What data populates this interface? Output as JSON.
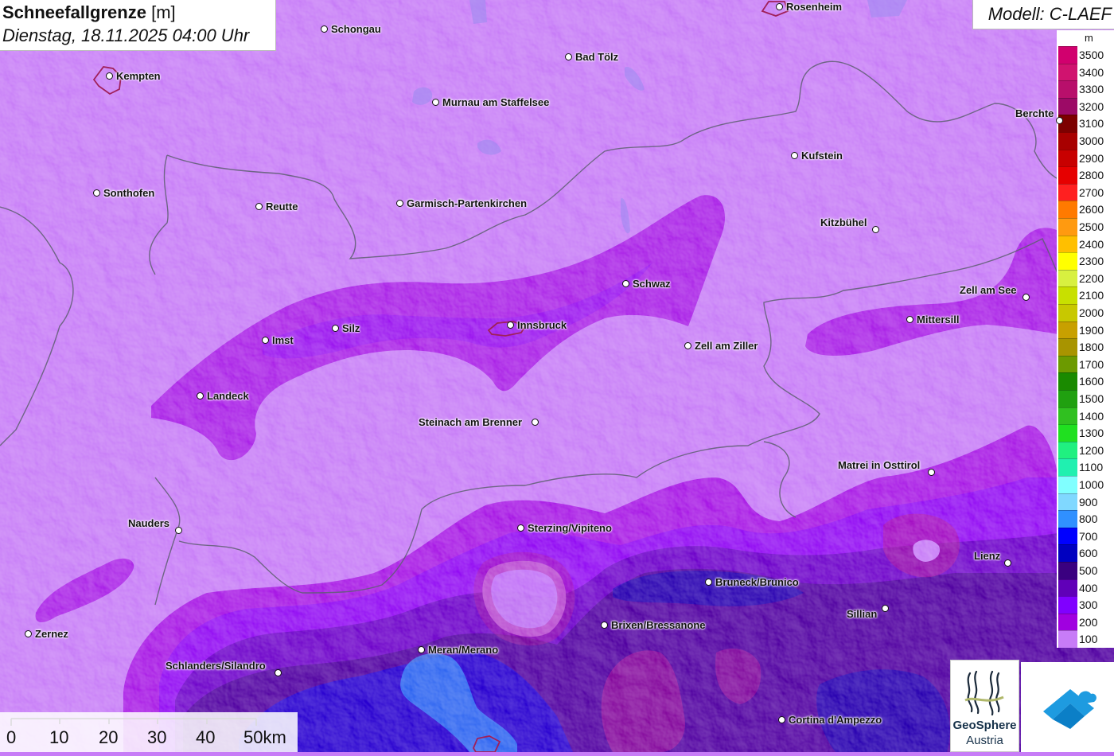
{
  "title": {
    "variable": "Schneefallgrenze",
    "unit": "[m]",
    "datetime": "Dienstag, 18.11.2025 04:00 Uhr"
  },
  "model_label": "Modell: C-LAEF",
  "legend": {
    "unit": "m",
    "entries": [
      {
        "label": "3500",
        "color": "#d1006e"
      },
      {
        "label": "3400",
        "color": "#d0136f"
      },
      {
        "label": "3300",
        "color": "#b80f6b"
      },
      {
        "label": "3200",
        "color": "#9c0a66"
      },
      {
        "label": "3100",
        "color": "#7d0000"
      },
      {
        "label": "3000",
        "color": "#a80000"
      },
      {
        "label": "2900",
        "color": "#c80000"
      },
      {
        "label": "2800",
        "color": "#e60000"
      },
      {
        "label": "2700",
        "color": "#ff2020"
      },
      {
        "label": "2600",
        "color": "#ff7a00"
      },
      {
        "label": "2500",
        "color": "#ff9a10"
      },
      {
        "label": "2400",
        "color": "#ffbf00"
      },
      {
        "label": "2300",
        "color": "#ffff00"
      },
      {
        "label": "2200",
        "color": "#d8f040"
      },
      {
        "label": "2100",
        "color": "#c8e000"
      },
      {
        "label": "2000",
        "color": "#c8c800"
      },
      {
        "label": "1900",
        "color": "#c8a000"
      },
      {
        "label": "1800",
        "color": "#a89400"
      },
      {
        "label": "1700",
        "color": "#6c9a00"
      },
      {
        "label": "1600",
        "color": "#1a8a00"
      },
      {
        "label": "1500",
        "color": "#20a010"
      },
      {
        "label": "1400",
        "color": "#30c020"
      },
      {
        "label": "1300",
        "color": "#20e020"
      },
      {
        "label": "1200",
        "color": "#20f080"
      },
      {
        "label": "1100",
        "color": "#20f0b0"
      },
      {
        "label": "1000",
        "color": "#80ffff"
      },
      {
        "label": "900",
        "color": "#80d8ff"
      },
      {
        "label": "800",
        "color": "#3090ff"
      },
      {
        "label": "700",
        "color": "#0000ff"
      },
      {
        "label": "600",
        "color": "#0000c0"
      },
      {
        "label": "500",
        "color": "#3a0080"
      },
      {
        "label": "400",
        "color": "#6000b8"
      },
      {
        "label": "300",
        "color": "#8000ff"
      },
      {
        "label": "200",
        "color": "#a000e0"
      },
      {
        "label": "100",
        "color": "#c77cf7"
      }
    ]
  },
  "cities": [
    {
      "name": "Rosenheim",
      "label_side": "right"
    },
    {
      "name": "Schongau",
      "label_side": "right"
    },
    {
      "name": "Kempten",
      "label_side": "right"
    },
    {
      "name": "Bad Tölz",
      "label_side": "right"
    },
    {
      "name": "Murnau am Staffelsee",
      "label_side": "right"
    },
    {
      "name": "Berchte",
      "label_side": "left"
    },
    {
      "name": "Kufstein",
      "label_side": "right"
    },
    {
      "name": "Sonthofen",
      "label_side": "right"
    },
    {
      "name": "Reutte",
      "label_side": "right"
    },
    {
      "name": "Garmisch-Partenkirchen",
      "label_side": "right"
    },
    {
      "name": "Kitzbühel",
      "label_side": "left"
    },
    {
      "name": "Schwaz",
      "label_side": "right"
    },
    {
      "name": "Zell am See",
      "label_side": "left"
    },
    {
      "name": "Mittersill",
      "label_side": "right"
    },
    {
      "name": "Imst",
      "label_side": "right"
    },
    {
      "name": "Silz",
      "label_side": "right"
    },
    {
      "name": "Innsbruck",
      "label_side": "right"
    },
    {
      "name": "Zell am Ziller",
      "label_side": "right"
    },
    {
      "name": "Landeck",
      "label_side": "right"
    },
    {
      "name": "Steinach am Brenner",
      "label_side": "left"
    },
    {
      "name": "Matrei in Osttirol",
      "label_side": "left"
    },
    {
      "name": "Nauders",
      "label_side": "left"
    },
    {
      "name": "Sterzing/Vipiteno",
      "label_side": "right"
    },
    {
      "name": "Lienz",
      "label_side": "left"
    },
    {
      "name": "Bruneck/Brunico",
      "label_side": "right"
    },
    {
      "name": "Sillian",
      "label_side": "left"
    },
    {
      "name": "Brixen/Bressanone",
      "label_side": "right"
    },
    {
      "name": "Zernez",
      "label_side": "right"
    },
    {
      "name": "Meran/Merano",
      "label_side": "right"
    },
    {
      "name": "Schlanders/Silandro",
      "label_side": "left"
    },
    {
      "name": "Cortina d'Ampezzo",
      "label_side": "right"
    }
  ],
  "scale_bar": {
    "ticks": [
      "0",
      "10",
      "20",
      "30",
      "40",
      "50km"
    ]
  },
  "logos": {
    "geosphere_line1": "GeoSphere",
    "geosphere_line2": "Austria"
  }
}
